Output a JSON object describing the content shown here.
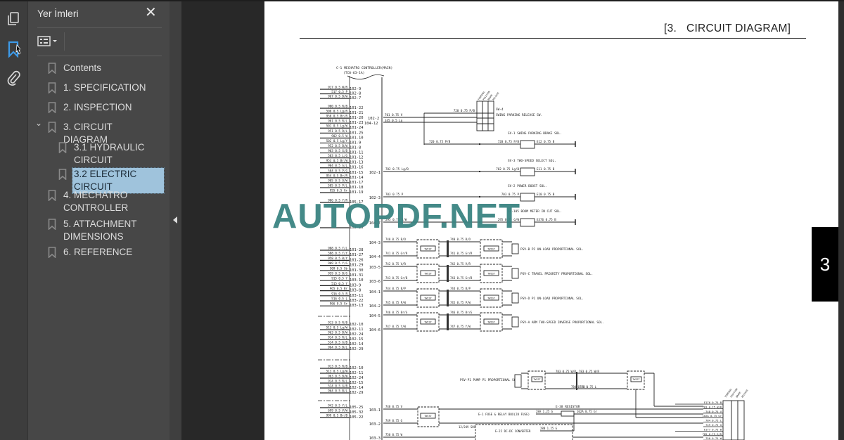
{
  "panel": {
    "title": "Yer İmleri",
    "bookmarks": [
      {
        "label": "Contents",
        "level": 0
      },
      {
        "label": "1. SPECIFICATION",
        "level": 0
      },
      {
        "label": "2. INSPECTION",
        "level": 0
      },
      {
        "label": "3. CIRCUIT DIAGRAM",
        "level": 0,
        "expanded": true
      },
      {
        "label": "3.1 HYDRAULIC CIRCUIT",
        "level": 1
      },
      {
        "label": "3.2 ELECTRIC CIRCUIT",
        "level": 1,
        "selected": true
      },
      {
        "label": "4. MECHATRO CONTROLLER",
        "level": 0
      },
      {
        "label": "5. ATTACHMENT DIMENSIONS",
        "level": 0
      },
      {
        "label": "6. REFERENCE",
        "level": 0
      }
    ]
  },
  "rail": {
    "icons": [
      "pages-icon",
      "bookmark-icon",
      "attachment-icon"
    ],
    "active": "bookmark-icon",
    "active_color": "#3d9ae8"
  },
  "page": {
    "header": "[3.   CIRCUIT DIAGRAM]",
    "tab_number": "3",
    "watermark": "AUTOPDF.NET",
    "watermark_color": "#3b8482"
  },
  "diagram": {
    "controller_title": "C-1 MECHATRO CONTROLLER(MAIN)",
    "controller_sub": "(TC0-63-1A)",
    "left_pins": [
      {
        "pin": "102-9",
        "wire": "917 0.5 W/R"
      },
      {
        "pin": "102-8",
        "wire": "517 0.5 P"
      },
      {
        "pin": "102-7",
        "wire": "967 0.5 B/W"
      },
      {
        "pin": "101-22",
        "wire": "900 0.5 R/B"
      },
      {
        "pin": "101-21",
        "wire": "500 0.5 Lg/R"
      },
      {
        "pin": "101-20",
        "wire": "950 0.5 Br/R"
      },
      {
        "pin": "101-23",
        "wire": "901 0.5 R/L"
      },
      {
        "pin": "101-24",
        "wire": "501 0.5 Lg/W"
      },
      {
        "pin": "101-25",
        "wire": "951 0.5 R/L"
      },
      {
        "pin": "101-10",
        "wire": "902 0.5 W"
      },
      {
        "pin": "101-9",
        "wire": "502 0.5 Lg/Y"
      },
      {
        "pin": "101-8",
        "wire": "952 0.5 B/W"
      },
      {
        "pin": "101-11",
        "wire": "903 0.5 G/B"
      },
      {
        "pin": "101-12",
        "wire": "503 0.5 L/G"
      },
      {
        "pin": "101-13",
        "wire": "953 0.5 Br/W"
      },
      {
        "pin": "101-16",
        "wire": "904 0.5 G/L"
      },
      {
        "pin": "101-15",
        "wire": "504 0.5 P/G"
      },
      {
        "pin": "101-14",
        "wire": "954 0.5 Br/R"
      },
      {
        "pin": "101-17",
        "wire": "905 0.5 O/W"
      },
      {
        "pin": "101-18",
        "wire": "505 0.5 P/L"
      },
      {
        "pin": "101-19",
        "wire": "955 0.5 Gr"
      },
      {
        "pin": "105-17",
        "wire": "906 0.5 Y/R"
      },
      {
        "pin": "102-25",
        "wire": ""
      },
      {
        "pin": "101-28",
        "wire": "908 0.5 Y/L"
      },
      {
        "pin": "101-27",
        "wire": "508 0.5 Y/Y"
      },
      {
        "pin": "101-26",
        "wire": "958 0.5 B/Y"
      },
      {
        "pin": "101-29",
        "wire": "909 0.5 Y/G"
      },
      {
        "pin": "101-30",
        "wire": "509 0.5 Sb"
      },
      {
        "pin": "101-31",
        "wire": "959 0.5 B/G"
      },
      {
        "pin": "103-10",
        "wire": "915 0.5 Y"
      },
      {
        "pin": "103-9",
        "wire": "515 0.5 Y"
      },
      {
        "pin": "103-8",
        "wire": "965 0.5 Br"
      },
      {
        "pin": "103-11",
        "wire": "916 0.5 R"
      },
      {
        "pin": "103-22",
        "wire": "516 0.5 L"
      },
      {
        "pin": "103-13",
        "wire": "966 0.5 Gr"
      },
      {
        "pin": "102-10",
        "wire": "913 0.5 R/B"
      },
      {
        "pin": "102-11",
        "wire": "513 0.5 Lg/W"
      },
      {
        "pin": "102-24",
        "wire": "963 0.5 B/W"
      },
      {
        "pin": "102-15",
        "wire": "914 0.5 R/L"
      },
      {
        "pin": "102-14",
        "wire": "514 0.5 G/B"
      },
      {
        "pin": "102-29",
        "wire": "964 0.5 B/L"
      },
      {
        "pin": "102-10",
        "wire": "913 0.5 R/B"
      },
      {
        "pin": "102-11",
        "wire": "513 0.5 Lg/W"
      },
      {
        "pin": "102-24",
        "wire": "963 0.5 B/W"
      },
      {
        "pin": "102-15",
        "wire": "914 0.5 R/L"
      },
      {
        "pin": "102-14",
        "wire": "514 0.5 G/B"
      },
      {
        "pin": "102-29",
        "wire": "964 0.5 B/L"
      },
      {
        "pin": "105-25",
        "wire": "942 0.5 Y/L"
      },
      {
        "pin": "105-32",
        "wire": "699 0.5 V/W"
      },
      {
        "pin": "105-22",
        "wire": "999 0.5 Br/B"
      }
    ],
    "switch": {
      "name": "SW-4",
      "desc": "SWING PARKING RELEASE SW.",
      "cols": [
        "TERMINAL",
        "POSITION",
        "BRAKE",
        "RELEASE"
      ],
      "pins": [
        "102-2",
        "104-12"
      ],
      "wires": [
        "701 0.75 V",
        "345 0.5 Lg",
        "720 0.75 P/B"
      ]
    },
    "solenoids": [
      {
        "pin": "",
        "title": "SV-1  SWING PARKING BRAKE SOL.",
        "wire_in": "720 0.75 P/B",
        "wire_mid": "720 0.75 P/B",
        "wire_out": "E12 0.75 B"
      },
      {
        "pin": "102-1",
        "title": "SV-3  TWO-SPEED SELECT SOL.",
        "wire_in": "702 0.75 Lg/B",
        "wire_mid": "702 0.75 Lg/B",
        "wire_out": "E11 0.75 B"
      },
      {
        "pin": "102-3",
        "title": "SV-2  POWER BOOST SOL.",
        "wire_in": "703 0.75 P",
        "wire_mid": "703 0.75 P",
        "wire_out": "E10 0.75 B"
      },
      {
        "pin": "104-7",
        "title": "SV-105  BOOM METER IN CUT SOL.",
        "wire_in": "295 0.75 G/W",
        "wire_mid": "295 0.75 G/W",
        "wire_out": "E376 0.75 B"
      }
    ],
    "twist_label": "TWIST",
    "proportional": [
      {
        "pins": [
          "104-3",
          "104-4"
        ],
        "wires": [
          "740 0.75 B/O",
          "741 0.75 Gr/R"
        ],
        "title": "PSV-B  P2 UN-LOAD PROPORTIONAL SOL."
      },
      {
        "pins": [
          "103-5",
          "103-6"
        ],
        "wires": [
          "742 0.75 V/R",
          "743 0.75 Gr/B"
        ],
        "title": "PSV-C  TRAVEL PRIORITY PROPORTIONAL SOL."
      },
      {
        "pins": [
          "104-1",
          "104-2"
        ],
        "wires": [
          "744 0.75 B/P",
          "745 0.75 P/W"
        ],
        "title": "PSV-D  P1 UN-LOAD PROPORTIONAL SOL."
      },
      {
        "pins": [
          "104-5",
          "104-6"
        ],
        "wires": [
          "746 0.75 Br/G",
          "747 0.75 Y/W"
        ],
        "title": "PSV-A  ARM TWO-SPEED INVERSE PROPORTIONAL SOL."
      }
    ],
    "bottom": {
      "pump_title": "PSV-P1  PUMP P1 PROPORTIONAL SOL.",
      "pump_wires": [
        "783 0.75 W/R",
        "784 0.75 L"
      ],
      "resistor": "E-38  RESISTOR",
      "fuse": "E-1  FUSE & RELAY BOX(28 FUSE)",
      "fuse_wire": "28A 1.25 G",
      "resistor_wire": "102A 0.75 Gr",
      "socket": "12/24V SOCKET",
      "converter": "E-22  DC-DC CONVERTER",
      "converter_wire": "28B 1.25 G",
      "rows": [
        {
          "pin": "103-1",
          "wire": "748 0.75 V"
        },
        {
          "pin": "103-2",
          "wire": "749 0.75 G"
        },
        {
          "pin": "103-3",
          "wire": "750 0.75 W"
        }
      ],
      "terminal_wires": [
        "E176 0.75 B",
        "783 0.75 W/R",
        "748 0.75 V",
        "102A 0.75 Gr",
        "784 0.75 L",
        "749 0.75 G",
        "E177 0.75 B",
        "785 0.75 G/R",
        "750 0.75 W"
      ]
    }
  }
}
